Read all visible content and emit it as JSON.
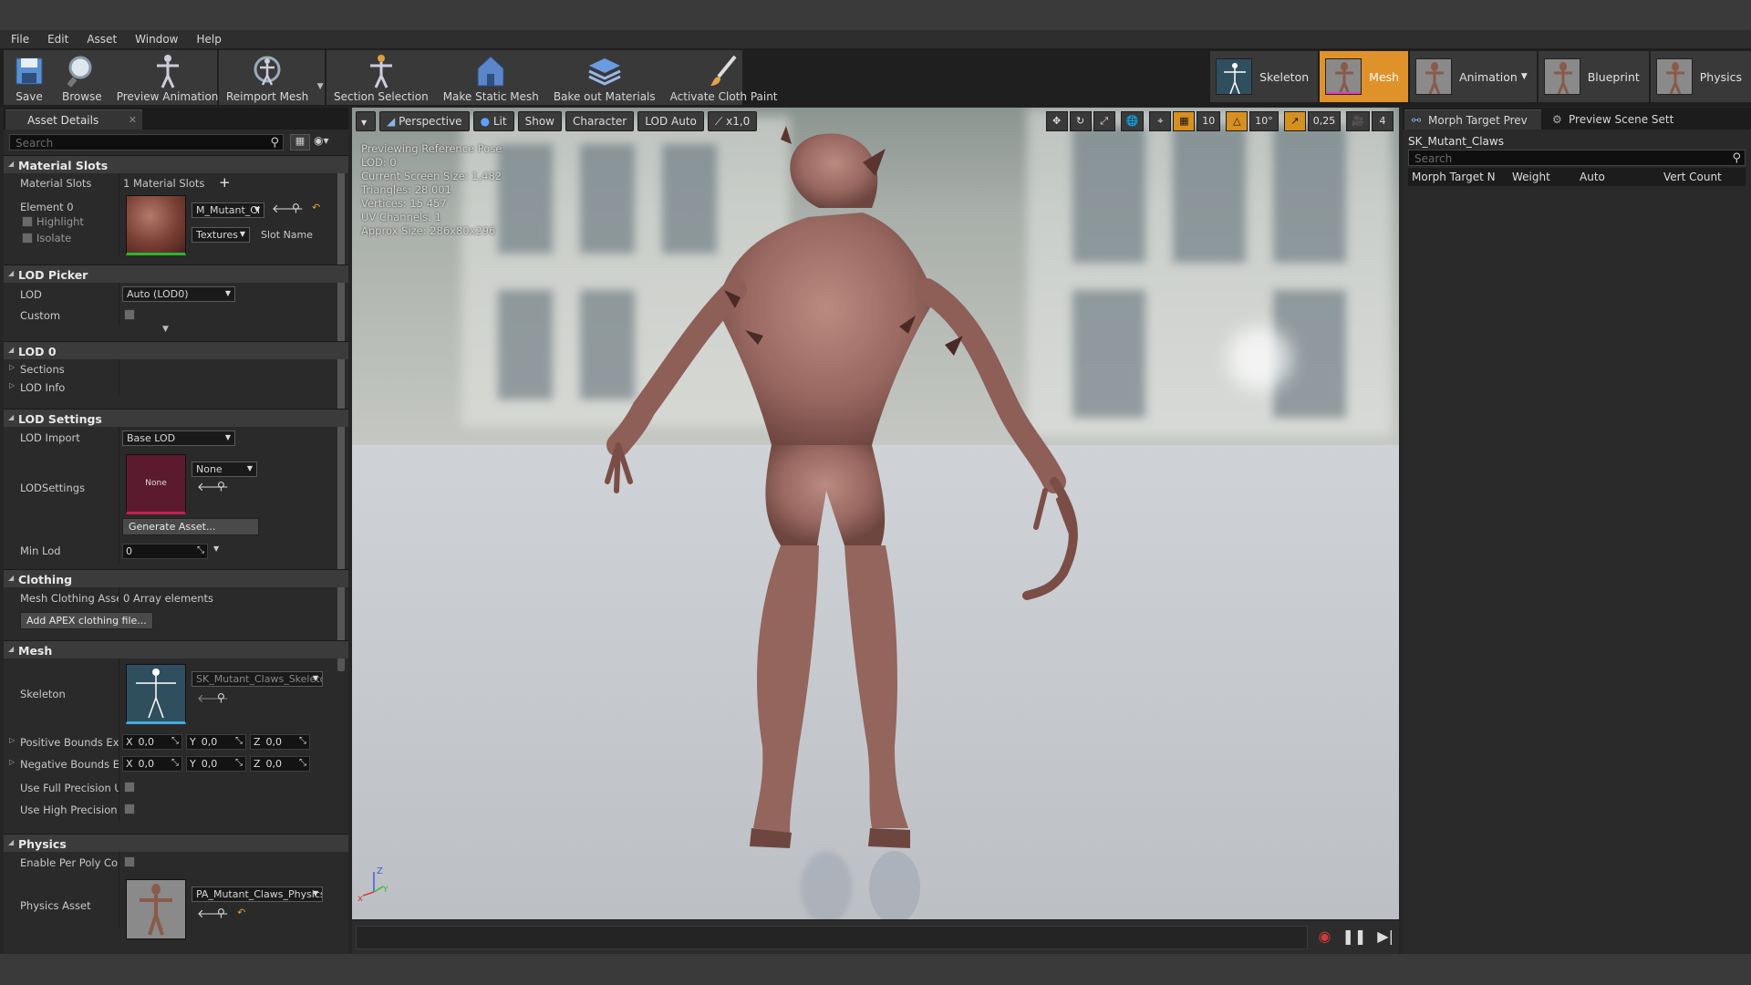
{
  "menu": [
    "File",
    "Edit",
    "Asset",
    "Window",
    "Help"
  ],
  "toolbar": {
    "save": "Save",
    "browse": "Browse",
    "preview_animation": "Preview Animation",
    "reimport_mesh": "Reimport Mesh",
    "section_selection": "Section Selection",
    "make_static_mesh": "Make Static Mesh",
    "bake_out_materials": "Bake out Materials",
    "activate_cloth_paint": "Activate Cloth Paint"
  },
  "modes": {
    "skeleton": "Skeleton",
    "mesh": "Mesh",
    "animation": "Animation",
    "blueprint": "Blueprint",
    "physics": "Physics",
    "active": "Mesh"
  },
  "asset_details": {
    "tab": "Asset Details",
    "search_placeholder": "Search",
    "material_slots": {
      "header": "Material Slots",
      "label": "Material Slots",
      "count": "1 Material Slots",
      "element": "Element 0",
      "highlight": "Highlight",
      "isolate": "Isolate",
      "material": "M_Mutant_Cl",
      "textures": "Textures",
      "slot_name": "Slot Name"
    },
    "lod_picker": {
      "header": "LOD Picker",
      "lod_label": "LOD",
      "lod_value": "Auto (LOD0)",
      "custom_label": "Custom"
    },
    "lod0": {
      "header": "LOD 0",
      "sections": "Sections",
      "lod_info": "LOD Info"
    },
    "lod_settings": {
      "header": "LOD Settings",
      "lod_import_label": "LOD Import",
      "lod_import_value": "Base LOD",
      "lodsettings_label": "LODSettings",
      "lodsettings_thumb": "None",
      "lodsettings_value": "None",
      "generate": "Generate Asset...",
      "min_lod_label": "Min Lod",
      "min_lod_value": "0"
    },
    "clothing": {
      "header": "Clothing",
      "mesh_clothing_label": "Mesh Clothing Assets",
      "mesh_clothing_value": "0 Array elements",
      "add_apex": "Add APEX clothing file..."
    },
    "mesh": {
      "header": "Mesh",
      "skeleton_label": "Skeleton",
      "skeleton_value": "SK_Mutant_Claws_Skeleton",
      "pos_bounds_label": "Positive Bounds Extension",
      "neg_bounds_label": "Negative Bounds Extension",
      "x": "0,0",
      "y": "0,0",
      "z": "0,0",
      "full_precision_uv": "Use Full Precision UVs",
      "high_precision": "Use High Precision Tangent Basis"
    },
    "physics": {
      "header": "Physics",
      "enable_per_poly": "Enable Per Poly Collision",
      "physics_asset_label": "Physics Asset",
      "physics_asset_value": "PA_Mutant_Claws_Physics"
    }
  },
  "viewport": {
    "perspective": "Perspective",
    "lit": "Lit",
    "show": "Show",
    "character": "Character",
    "lod_auto": "LOD Auto",
    "speed": "x1,0",
    "grid": "10",
    "rot": "10°",
    "scale": "0,25",
    "cam": "4",
    "info": [
      "Previewing Reference Pose",
      "LOD: 0",
      "Current Screen Size: 1,482",
      "Triangles: 28 001",
      "Vertices: 15 457",
      "UV Channels: 1",
      "Approx Size: 286x80x296"
    ]
  },
  "right_panel": {
    "tab1": "Morph Target Prev",
    "tab2": "Preview Scene Sett",
    "asset": "SK_Mutant_Claws",
    "search_placeholder": "Search",
    "columns": [
      "Morph Target N",
      "Weight",
      "Auto",
      "Vert Count"
    ]
  }
}
